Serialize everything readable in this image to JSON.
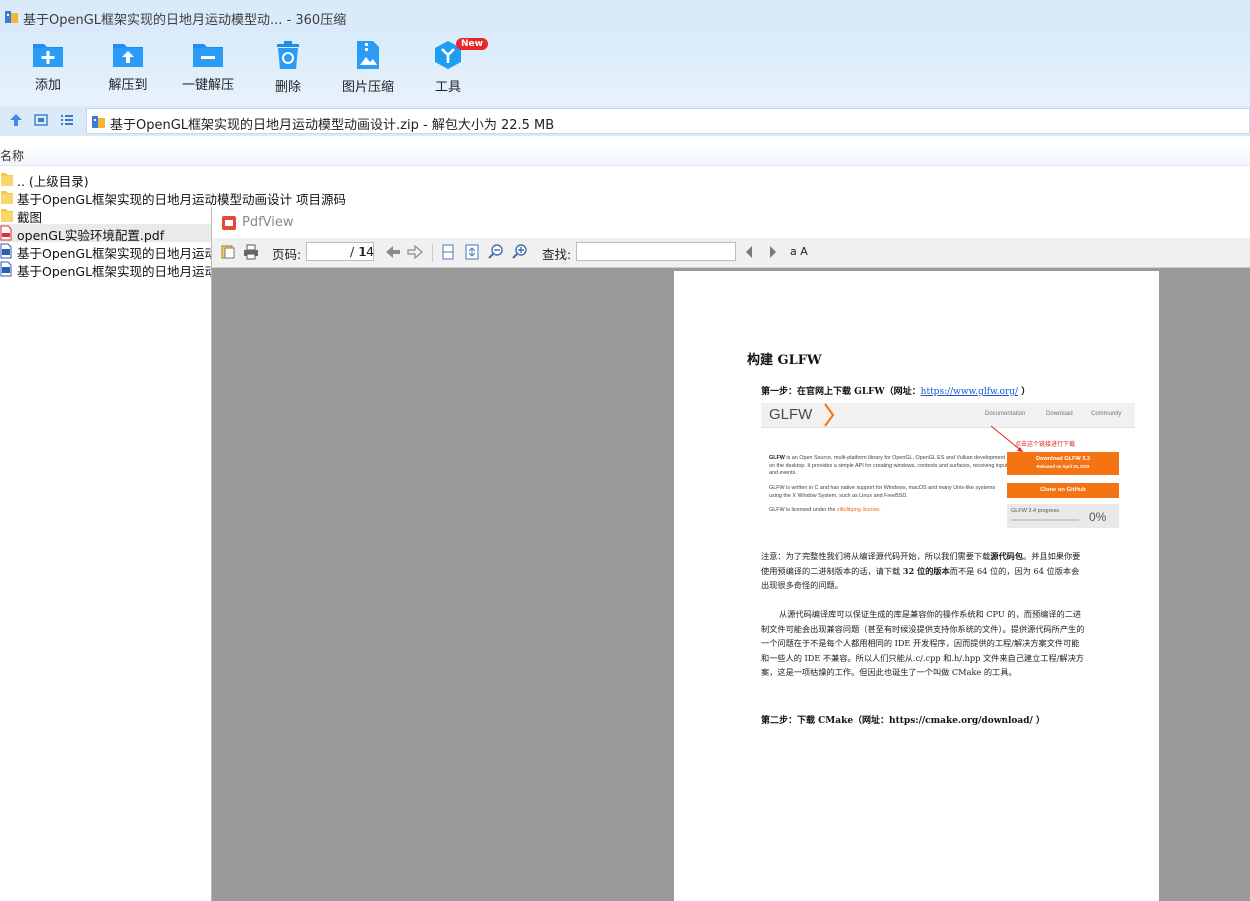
{
  "window": {
    "title": "基于OpenGL框架实现的日地月运动模型动... - 360压缩"
  },
  "toolbar": {
    "add": "添加",
    "extract_to": "解压到",
    "one_click_extract": "一键解压",
    "delete": "删除",
    "image_compress": "图片压缩",
    "tools": "工具",
    "tools_badge": "New"
  },
  "address": {
    "path": "基于OpenGL框架实现的日地月运动模型动画设计.zip - 解包大小为 22.5 MB"
  },
  "list": {
    "column_name": "名称",
    "items": [
      {
        "name": ".. (上级目录)",
        "type": "folder"
      },
      {
        "name": "基于OpenGL框架实现的日地月运动模型动画设计 项目源码",
        "type": "folder"
      },
      {
        "name": "截图",
        "type": "folder"
      },
      {
        "name": "openGL实验环境配置.pdf",
        "type": "pdf"
      },
      {
        "name": "基于OpenGL框架实现的日地月运动",
        "type": "doc"
      },
      {
        "name": "基于OpenGL框架实现的日地月运动",
        "type": "doc"
      }
    ]
  },
  "pdfview": {
    "title": "PdfView",
    "page_label": "页码:",
    "current_page": "1",
    "total_pages": "/ 14",
    "find_label": "查找:",
    "find_value": "",
    "font_icon_text": "a A"
  },
  "doc": {
    "heading": "构建 GLFW",
    "step1_text": "第一步：在官网上下载 GLFW（网址：",
    "step1_link": "https://www.glfw.org/",
    "step1_end": " ）",
    "glfw_shot": {
      "logo": "GLFW",
      "nav_documentation": "Documentation",
      "nav_download": "Download",
      "nav_community": "Community",
      "annotation": "点击这个链接进行下载",
      "p1_bold": "GLFW",
      "p1": " is an Open Source, multi-platform library for OpenGL, OpenGL ES and Vulkan development on the desktop. It provides a simple API for creating windows, contexts and surfaces, receiving input and events.",
      "p2": "GLFW is written in C and has native support for Windows, macOS and many Unix-like systems using the X Window System, such as Linux and FreeBSD.",
      "p3_pre": "GLFW is licensed under the ",
      "p3_link": "zlib/libpng license",
      "p3_end": ".",
      "btn_download": "Download GLFW 3.3",
      "btn_download_sub": "Released on April 15, 2019",
      "btn_clone": "Clone on GitHub",
      "progress_label": "GLFW 3.4 progress",
      "progress_percent": "0%"
    },
    "note_a": "注意：为了完整性我们将从编译源代码开始，所以我们需要下载",
    "note_b": "源代码包",
    "note_c": "。并且如果你要使用预编译的二进制版本的话，请下载 ",
    "note_d": "32 位的版本",
    "note_e": "而不是 64 位的，因为 64 位版本会出现很多奇怪的问题。",
    "para2": "从源代码编译库可以保证生成的库是兼容你的操作系统和 CPU 的，而预编译的二进制文件可能会出现兼容问题（甚至有时候没提供支持你系统的文件）。提供源代码所产生的一个问题在于不是每个人都用相同的 IDE 开发程序，因而提供的工程/解决方案文件可能和一些人的 IDE 不兼容。所以人们只能从.c/.cpp 和.h/.hpp 文件来自己建立工程/解决方案，这是一项枯燥的工作。但因此也诞生了一个叫做 CMake 的工具。",
    "step2": "第二步：下载 CMake（网址：https://cmake.org/download/ ）"
  }
}
